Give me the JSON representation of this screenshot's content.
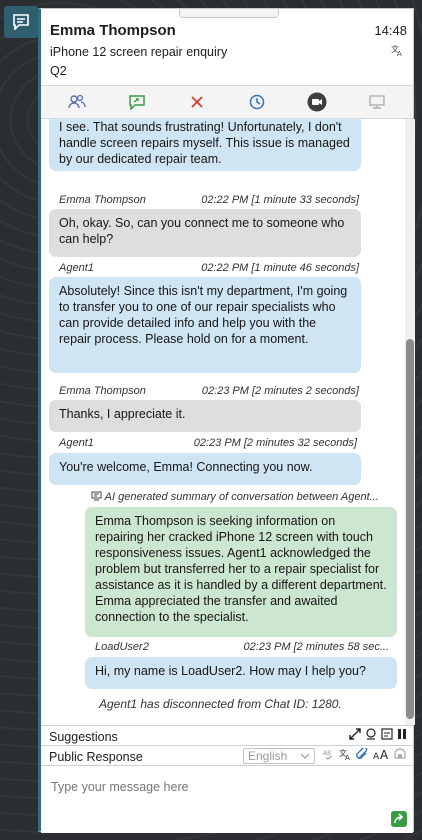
{
  "header": {
    "customer_name": "Emma Thompson",
    "time": "14:48",
    "subject": "iPhone 12 screen repair enquiry",
    "queue": "Q2"
  },
  "toolbar": {
    "icons": [
      "participants-icon",
      "transfer-icon",
      "close-icon",
      "history-icon",
      "video-icon",
      "screen-share-icon"
    ]
  },
  "messages": [
    {
      "text": "I see. That sounds frustrating! Unfortunately, I don't handle screen repairs myself. This issue is managed by our dedicated repair team."
    },
    {
      "sender": "Emma Thompson",
      "timestamp": "02:22 PM [1 minute 33 seconds]",
      "text": "Oh, okay. So, can you connect me to someone who can help?"
    },
    {
      "sender": "Agent1",
      "timestamp": "02:22 PM [1 minute 46 seconds]",
      "text": "Absolutely! Since this isn't my department, I'm going to transfer you to one of our repair specialists who can provide detailed info and help you with the repair process. Please hold on for a moment."
    },
    {
      "sender": "Emma Thompson",
      "timestamp": "02:23 PM [2 minutes 2 seconds]",
      "text": "Thanks, I appreciate it."
    },
    {
      "sender": "Agent1",
      "timestamp": "02:23 PM [2 minutes 32 seconds]",
      "text": "You're welcome, Emma! Connecting you now."
    },
    {
      "sender": "AI generated summary of conversation between Agent...",
      "text": "Emma Thompson is seeking information on repairing her cracked iPhone 12 screen with touch responsiveness issues. Agent1 acknowledged the problem but transferred her to a repair specialist for assistance as it is handled by a different department. Emma appreciated the transfer and awaited connection to the specialist."
    },
    {
      "sender": "LoadUser2",
      "timestamp": "02:23 PM [2 minutes 58 sec...",
      "text": "Hi, my name is LoadUser2. How may I help you?"
    }
  ],
  "system_message": "Agent1 has disconnected from Chat ID: 1280.",
  "suggestions_label": "Suggestions",
  "public_response_label": "Public Response",
  "language": "English",
  "compose_placeholder": "Type your message here",
  "colors": {
    "agent_bubble": "#cfe5f3",
    "customer_bubble": "#dedede",
    "summary_bubble": "#cde6cf",
    "accent": "#346c80",
    "send": "#3a9b47"
  }
}
